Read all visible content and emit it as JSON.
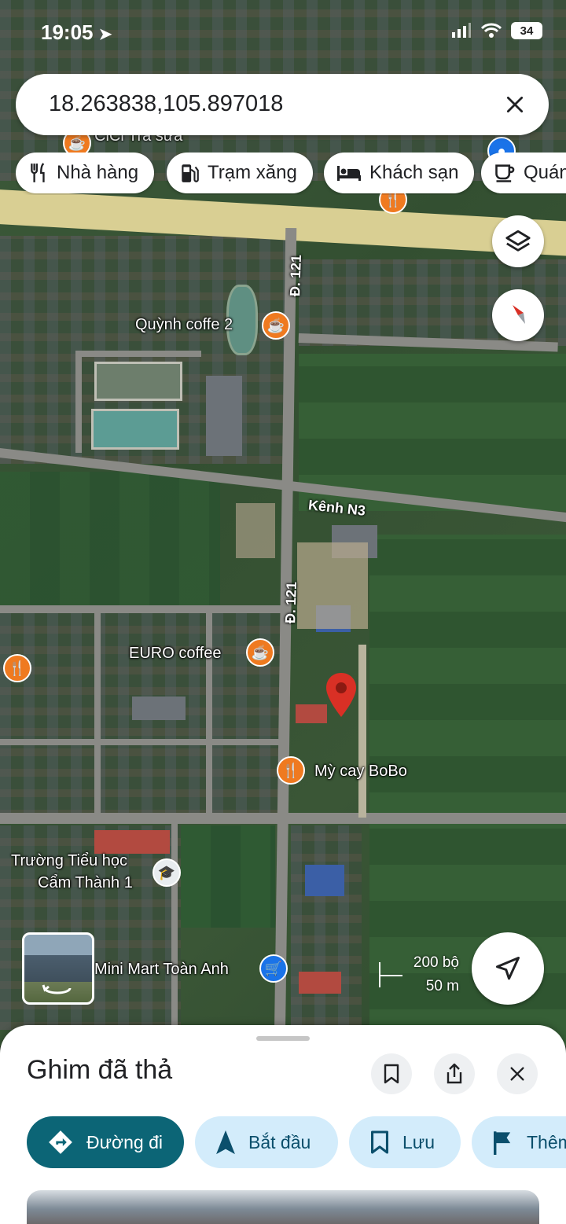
{
  "status_bar": {
    "time": "19:05",
    "battery": "34"
  },
  "search": {
    "query": "18.263838,105.897018"
  },
  "chips": [
    {
      "label": "Nhà hàng",
      "icon": "fork-knife-icon"
    },
    {
      "label": "Trạm xăng",
      "icon": "gas-station-icon"
    },
    {
      "label": "Khách sạn",
      "icon": "bed-icon"
    },
    {
      "label": "Quán",
      "icon": "coffee-icon"
    }
  ],
  "map": {
    "labels": {
      "quynh_coffe": "Quỳnh coffe 2",
      "euro_coffee": "EURO coffee",
      "my_cay": "Mỳ cay BoBo",
      "school_line1": "Trường Tiểu học",
      "school_line2": "Cẩm Thành 1",
      "mini_mart": "Mini Mart Toàn Anh",
      "road_121_top": "Đ. 121",
      "road_121_mid": "Đ. 121",
      "canal": "Kênh N3",
      "top_partial": "CiCi Trà sữa"
    },
    "scale": {
      "feet": "200 bộ",
      "meters": "50 m"
    }
  },
  "sheet": {
    "title": "Ghim đã thả",
    "actions": [
      {
        "label": "Đường đi",
        "icon": "directions-icon"
      },
      {
        "label": "Bắt đầu",
        "icon": "navigation-arrow-icon"
      },
      {
        "label": "Lưu",
        "icon": "bookmark-icon"
      },
      {
        "label": "Thêm",
        "icon": "flag-icon"
      }
    ]
  },
  "colors": {
    "accent": "#0c6576",
    "pin": "#d93025",
    "poi_food": "#ef7a20",
    "poi_shop": "#1a73e8"
  }
}
